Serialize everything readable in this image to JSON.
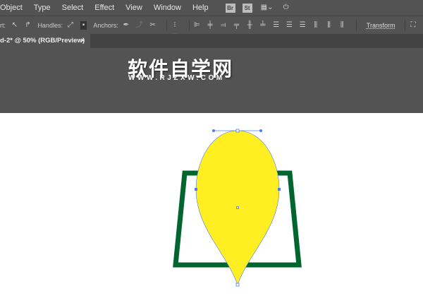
{
  "menu": [
    "Object",
    "Type",
    "Select",
    "Effect",
    "View",
    "Window",
    "Help"
  ],
  "menu_badges": [
    "Br",
    "St"
  ],
  "control": {
    "cut_label": "rt:",
    "handles_label": "Handles:",
    "anchors_label": "Anchors:",
    "transform_label": "Transform"
  },
  "tab": {
    "title": "d-2* @ 50% (RGB/Preview)",
    "close": "×"
  },
  "watermark": {
    "title": "软件自学网",
    "url": "WWW.RJZXW.COM"
  },
  "colors": {
    "yellow": "#FFEE22",
    "green": "#00652E",
    "selection": "#4A7CF7"
  }
}
